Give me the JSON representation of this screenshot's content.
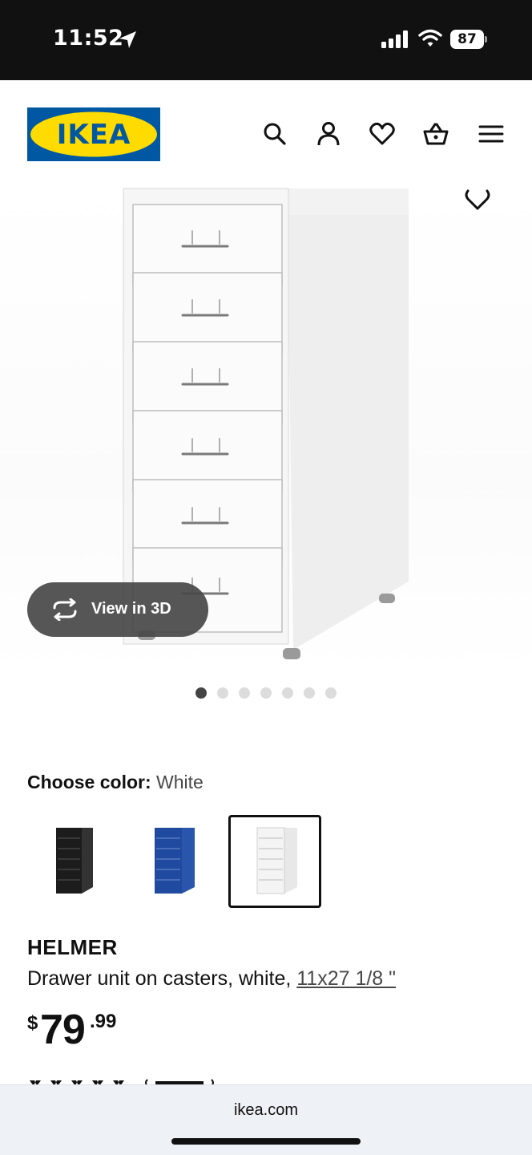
{
  "status_bar": {
    "time": "11:52",
    "battery": "87",
    "icons": [
      "location-arrow-icon",
      "cellular-signal-icon",
      "wifi-icon",
      "battery-icon"
    ]
  },
  "header": {
    "logo_text": "IKEA",
    "brand_colors": {
      "blue": "#0058A3",
      "yellow": "#FFDB00"
    },
    "nav_icons": [
      "search-icon",
      "account-icon",
      "favorites-icon",
      "cart-icon",
      "menu-icon"
    ]
  },
  "gallery": {
    "view_3d_label": "View in 3D",
    "image_count": 7,
    "active_image": 1
  },
  "color_choice": {
    "label": "Choose color:",
    "selected_value": "White",
    "swatches": [
      {
        "color": "#1c1c1c",
        "selected": false
      },
      {
        "color": "#1f4aa0",
        "selected": false
      },
      {
        "color": "#f4f4f4",
        "selected": true
      }
    ]
  },
  "product": {
    "name": "HELMER",
    "description": "Drawer unit on casters, white,",
    "size": "11x27 1/8 \"",
    "price_currency": "$",
    "price_int": "79",
    "price_dec": ".99"
  },
  "browser": {
    "url": "ikea.com"
  }
}
